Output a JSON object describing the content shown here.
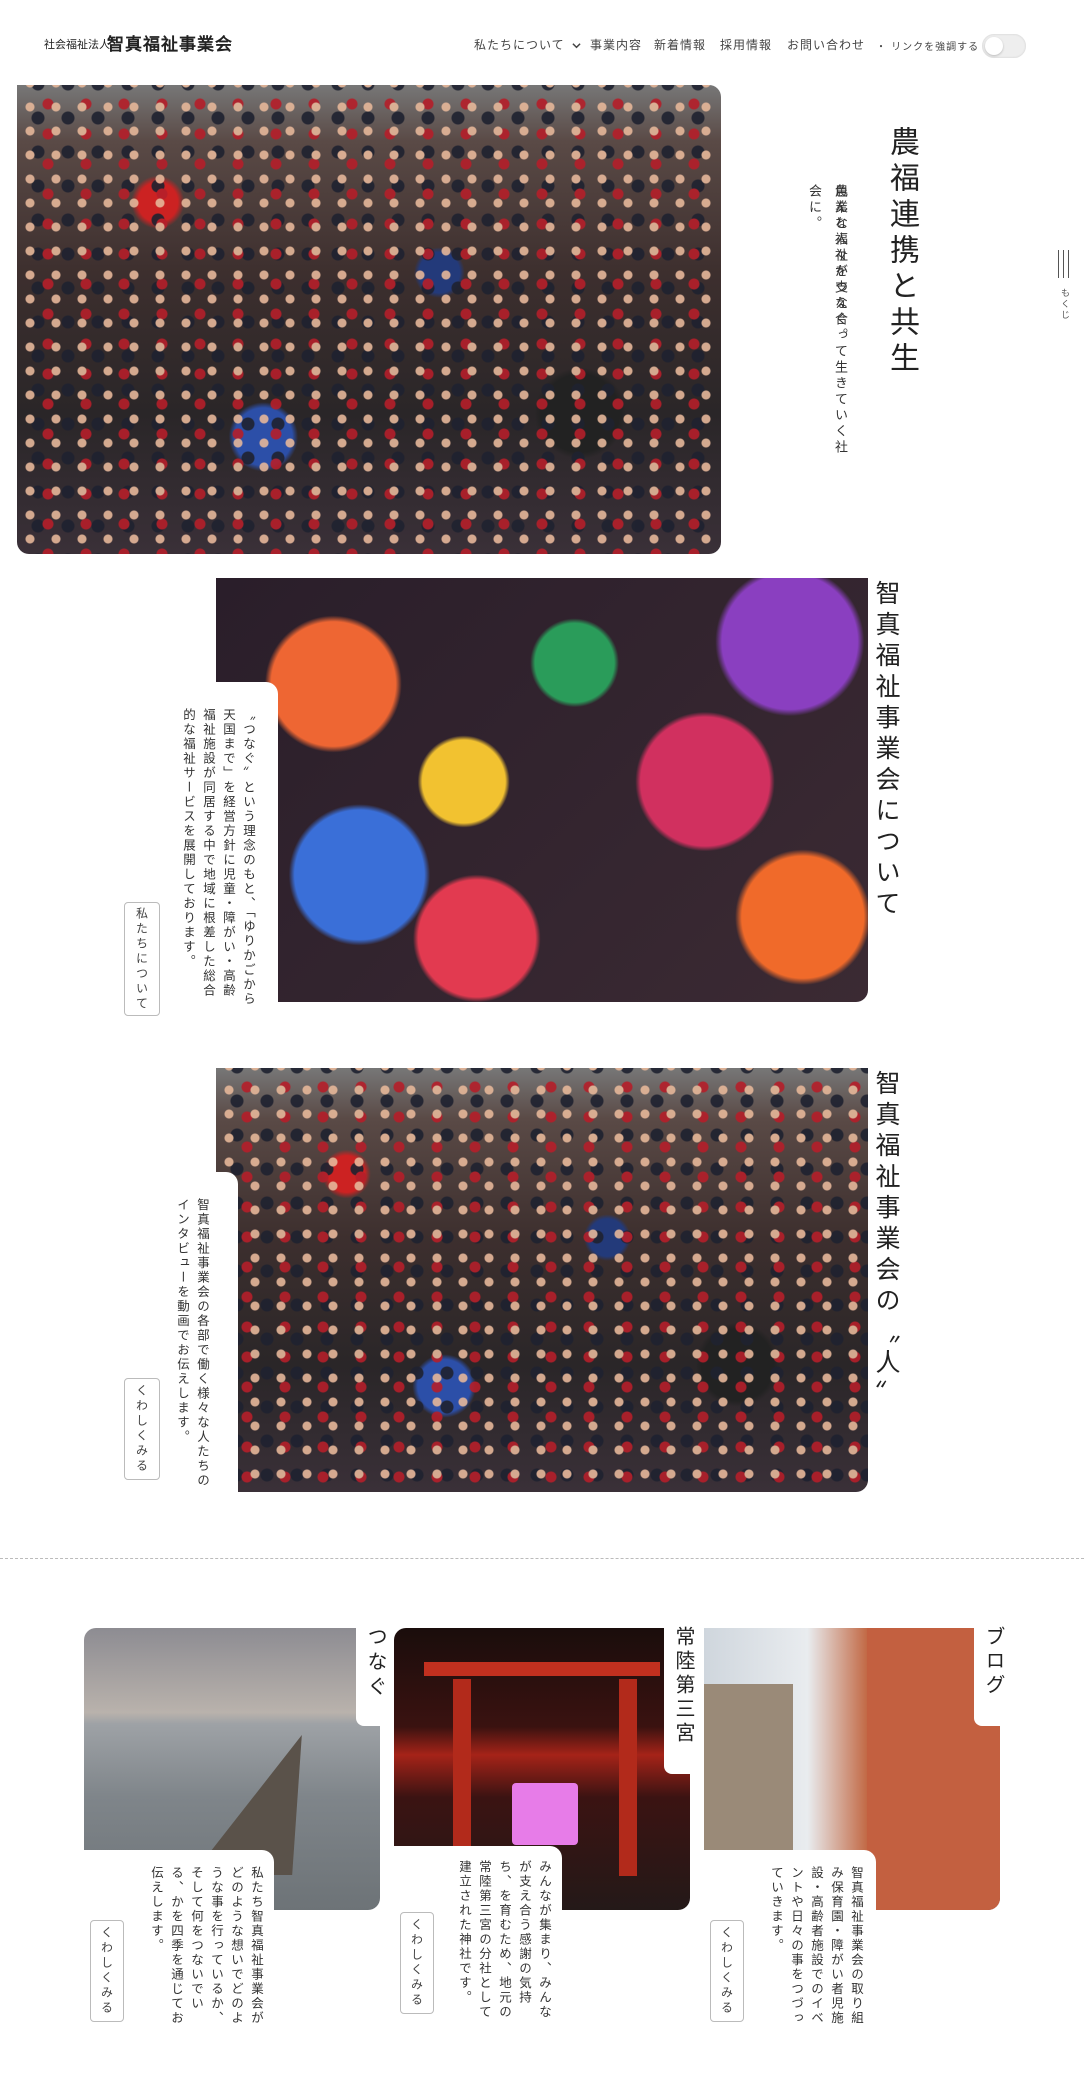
{
  "header": {
    "org_prefix": "社会福祉法人",
    "org_name": "智真福祉事業会",
    "nav": [
      {
        "label": "私たちについて"
      },
      {
        "label": "事業内容"
      },
      {
        "label": "新着情報"
      },
      {
        "label": "採用情報"
      },
      {
        "label": "お問い合わせ"
      }
    ],
    "link_emphasis_label": "・ リンクを強調する",
    "link_emphasis_on": false
  },
  "toc": {
    "label": "もくじ"
  },
  "hero": {
    "title": "農福連携と共生",
    "lead_1": "農業と福祉をつなぐ。",
    "lead_2": "色んな人々が支え合って生きていく社会に。"
  },
  "about": {
    "title": "智真福祉事業会について",
    "body": "〝つなぐ〟という理念のもと、「ゆりかごから天国まで」を経営方針に児童・障がい・高齢福祉施設が同居する中で地域に根差した総合的な福祉サービスを展開しております。",
    "button": "私たちについて"
  },
  "people": {
    "title": "智真福祉事業会の〝人〟",
    "body": "智真福祉事業会の各部で働く様々な人たちのインタビューを動画でお伝えします。",
    "button": "くわしくみる"
  },
  "cards": [
    {
      "label": "つなぐ",
      "body": "私たち智真福祉事業会がどのような想いでどのような事を行っているか、そして何をつないでいる、かを四季を通じてお伝えします。",
      "button": "くわしくみる"
    },
    {
      "label": "常陸第三宮",
      "body": "みんなが集まり、みんなが支え合う感謝の気持ち、を育むため、地元の常陸第三宮の分社として建立された神社です。",
      "button": "くわしくみる"
    },
    {
      "label": "ブログ",
      "body": "智真福祉事業会の取り組み保育園・障がい者児施設・高齢者施設でのイベントや日々の事をつづっていきます。",
      "button": "くわしくみる"
    }
  ]
}
